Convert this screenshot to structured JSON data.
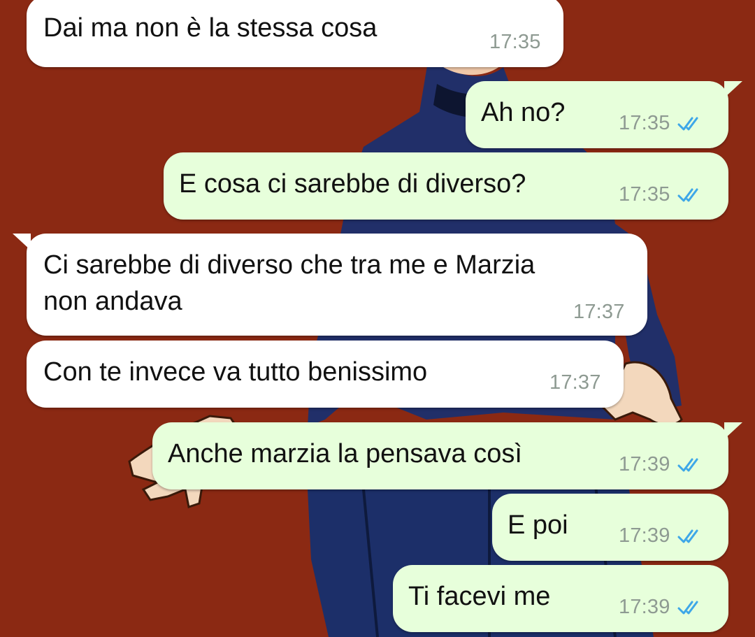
{
  "chat": {
    "messages": [
      {
        "direction": "incoming",
        "lines": [
          "Dai ma non è la stessa cosa"
        ],
        "time": "17:35"
      },
      {
        "direction": "outgoing",
        "lines": [
          "Ah no?"
        ],
        "time": "17:35",
        "status": "read-double-check"
      },
      {
        "direction": "outgoing",
        "lines": [
          "E cosa ci sarebbe di diverso?"
        ],
        "time": "17:35",
        "status": "read-double-check"
      },
      {
        "direction": "incoming",
        "lines": [
          "Ci sarebbe di diverso che tra me e Marzia",
          "non andava"
        ],
        "time": "17:37"
      },
      {
        "direction": "incoming",
        "lines": [
          "Con te invece va tutto benissimo"
        ],
        "time": "17:37"
      },
      {
        "direction": "outgoing",
        "lines": [
          "Anche marzia la pensava così"
        ],
        "time": "17:39",
        "status": "read-double-check"
      },
      {
        "direction": "outgoing",
        "lines": [
          "E poi"
        ],
        "time": "17:39",
        "status": "read-double-check"
      },
      {
        "direction": "outgoing",
        "lines": [
          "Ti facevi me"
        ],
        "time": "17:39",
        "status": "read-double-check"
      }
    ]
  },
  "colors": {
    "wallpaper": "#8f2b14",
    "incoming_bubble": "#ffffff",
    "outgoing_bubble": "#e7ffdb",
    "timestamp": "#8e9a92",
    "read_ticks": "#3ea7e8"
  },
  "icons": {
    "read_status": "double-check-icon",
    "wallpaper": "cartoon-character-wallpaper"
  }
}
